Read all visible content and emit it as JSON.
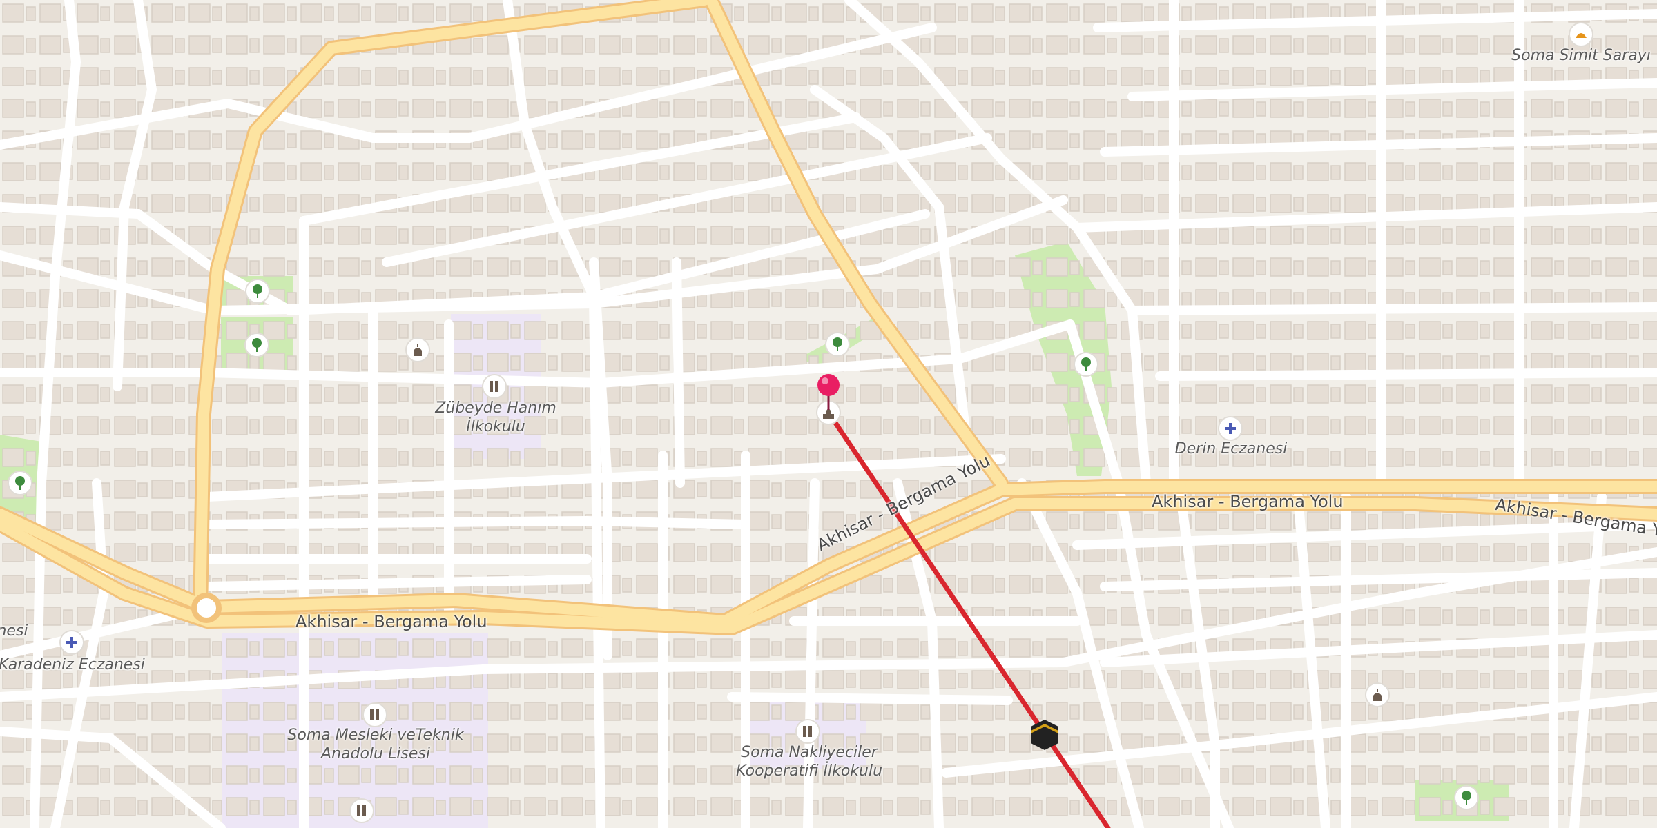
{
  "map": {
    "colors": {
      "background": "#f2efe9",
      "building": "#e6ded5",
      "street": "#ffffff",
      "main_road": "#fde4a1",
      "main_road_casing": "#f2c27a",
      "park": "#cdebb2",
      "school": "#ede6f6",
      "route_line": "#d9262e",
      "pin": "#e91e63"
    },
    "roads": [
      {
        "id": "road-akhisar-bergama-1",
        "name": "Akhisar - Bergama Yolu"
      },
      {
        "id": "road-akhisar-bergama-2",
        "name": "Akhisar - Bergama Yolu"
      },
      {
        "id": "road-akhisar-bergama-3",
        "name": "Akhisar - Bergama Yolu"
      },
      {
        "id": "road-akhisar-bergama-4",
        "name": "Akhisar - Bergama Yolu"
      }
    ],
    "places": [
      {
        "id": "zubeyde-hanim-ilkokulu",
        "line1": "Zübeyde Hanım",
        "line2": "İlkokulu",
        "icon": "school-icon"
      },
      {
        "id": "derin-eczanesi",
        "line1": "Derin Eczanesi",
        "line2": "",
        "icon": "pharmacy-icon"
      },
      {
        "id": "karadeniz-eczanesi",
        "line1": "Karadeniz Eczanesi",
        "line2": "",
        "icon": "pharmacy-icon"
      },
      {
        "id": "partial-eczanesi",
        "line1": "nesi",
        "line2": ""
      },
      {
        "id": "soma-mesleki",
        "line1": "Soma Mesleki veTeknik",
        "line2": "Anadolu Lisesi",
        "icon": "school-icon"
      },
      {
        "id": "soma-nakliyeciler",
        "line1": "Soma Nakliyeciler",
        "line2": "Kooperatifi İlkokulu",
        "icon": "school-icon"
      },
      {
        "id": "soma-simit-sarayi",
        "line1": "Soma Simit Sarayı",
        "line2": "",
        "icon": "bakery-icon"
      }
    ],
    "icons": [
      "park-icon",
      "mosque-icon",
      "school-icon",
      "pharmacy-icon",
      "bakery-icon",
      "kaaba-icon",
      "location-pin-icon"
    ]
  }
}
